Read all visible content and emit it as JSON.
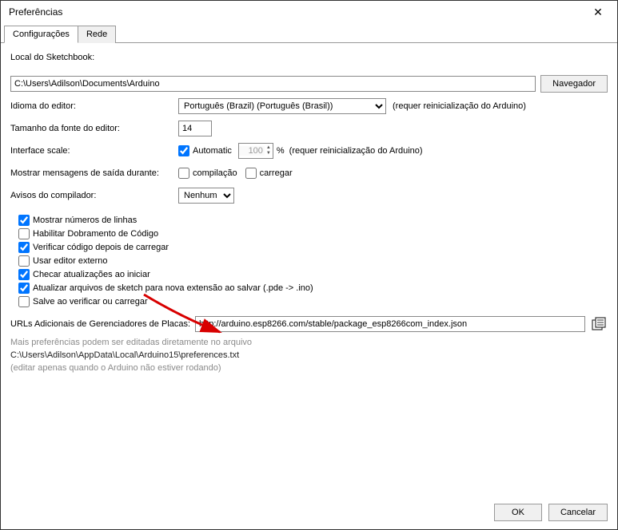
{
  "window": {
    "title": "Preferências",
    "close": "✕"
  },
  "tabs": [
    "Configurações",
    "Rede"
  ],
  "sketchbook": {
    "label": "Local do Sketchbook:",
    "value": "C:\\Users\\Adilson\\Documents\\Arduino",
    "browse": "Navegador"
  },
  "language": {
    "label": "Idioma do editor:",
    "value": "Português (Brazil) (Português (Brasil))",
    "hint": "(requer reinicialização do Arduino)"
  },
  "font": {
    "label": "Tamanho da fonte do editor:",
    "value": "14"
  },
  "scale": {
    "label": "Interface scale:",
    "auto": "Automatic",
    "value": "100",
    "pct": "%",
    "hint": "(requer reinicialização do Arduino)"
  },
  "output_msgs": {
    "label": "Mostrar mensagens de saída durante:",
    "compile": "compilação",
    "upload": "carregar"
  },
  "compiler_warnings": {
    "label": "Avisos do compilador:",
    "value": "Nenhum"
  },
  "checkboxes": {
    "line_numbers": "Mostrar números de linhas",
    "code_folding": "Habilitar Dobramento de Código",
    "verify_after_upload": "Verificar código depois de carregar",
    "external_editor": "Usar editor externo",
    "check_updates": "Checar atualizações ao iniciar",
    "update_ext": "Atualizar arquivos de sketch para nova extensão ao salvar (.pde -> .ino)",
    "save_on_verify": "Salve ao verificar ou carregar"
  },
  "checkbox_state": {
    "line_numbers": true,
    "code_folding": false,
    "verify_after_upload": true,
    "external_editor": false,
    "check_updates": true,
    "update_ext": true,
    "save_on_verify": false
  },
  "urls": {
    "label": "URLs Adicionais de Gerenciadores de Placas:",
    "value": "http://arduino.esp8266.com/stable/package_esp8266com_index.json"
  },
  "more_prefs": "Mais preferências podem ser editadas diretamente no arquivo",
  "prefs_file": "C:\\Users\\Adilson\\AppData\\Local\\Arduino15\\preferences.txt",
  "edit_hint": "(editar apenas quando o Arduino não estiver rodando)",
  "footer": {
    "ok": "OK",
    "cancel": "Cancelar"
  }
}
